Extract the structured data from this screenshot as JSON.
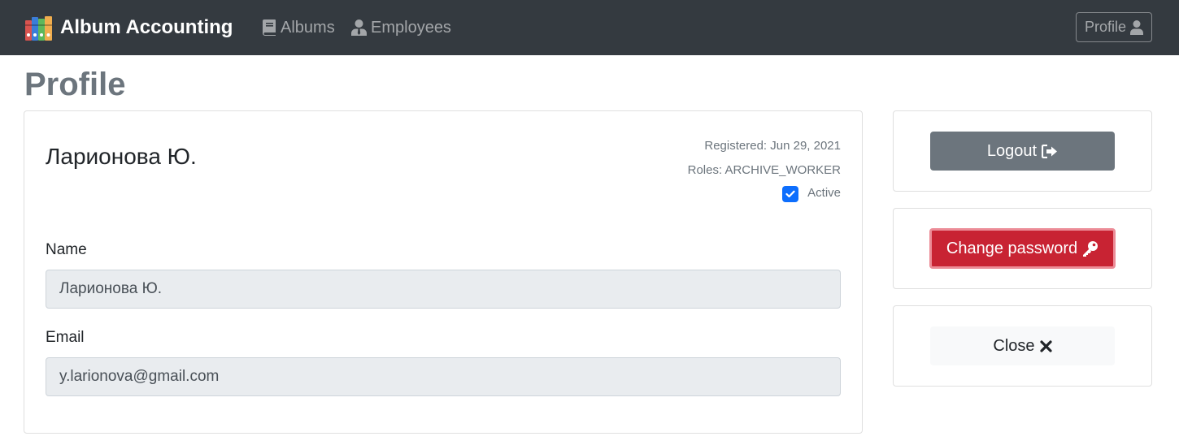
{
  "navbar": {
    "brand": "Album Accounting",
    "links": [
      {
        "label": "Albums",
        "icon": "book-icon"
      },
      {
        "label": "Employees",
        "icon": "user-tie-icon"
      }
    ],
    "profile_button": {
      "label": "Profile",
      "icon": "user-icon"
    }
  },
  "page": {
    "title": "Profile"
  },
  "profile": {
    "name": "Ларионова Ю.",
    "registered": "Registered: Jun 29, 2021",
    "roles": "Roles: ARCHIVE_WORKER",
    "active_label": "Active",
    "active": true,
    "fields": {
      "name_label": "Name",
      "name_value": "Ларионова Ю.",
      "email_label": "Email",
      "email_value": "y.larionova@gmail.com"
    }
  },
  "actions": {
    "logout": {
      "label": "Logout",
      "icon": "sign-out-icon"
    },
    "change_password": {
      "label": "Change password",
      "icon": "key-icon"
    },
    "close": {
      "label": "Close",
      "icon": "times-icon"
    }
  },
  "colors": {
    "navbar_bg": "#343a40",
    "secondary": "#6c757d",
    "danger": "#c82333",
    "primary": "#0d6efd",
    "input_bg": "#e9ecef"
  }
}
